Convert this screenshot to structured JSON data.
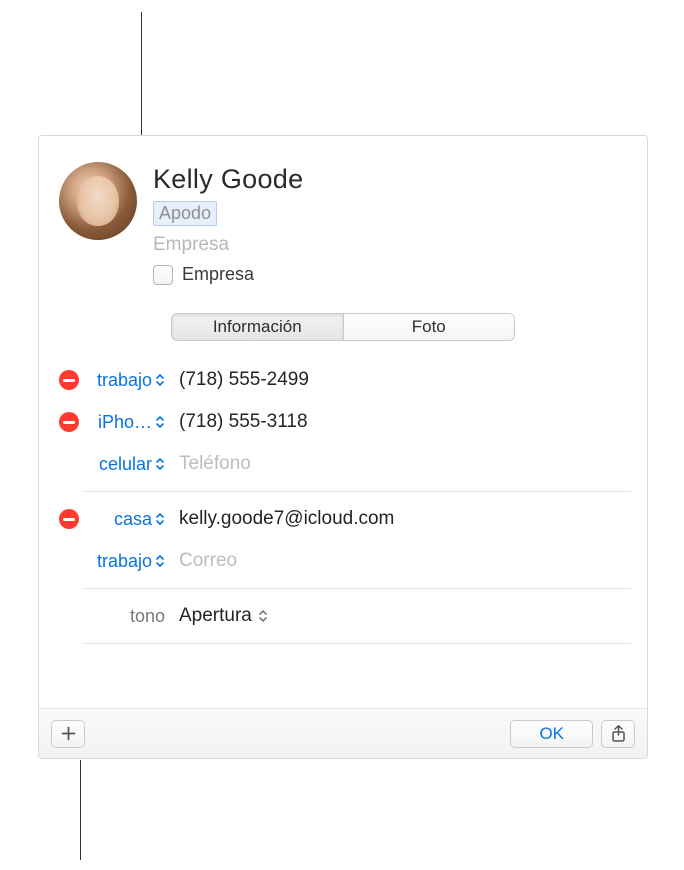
{
  "contact": {
    "name": "Kelly  Goode",
    "nickname_placeholder": "Apodo",
    "company_placeholder": "Empresa",
    "company_checkbox_label": "Empresa"
  },
  "tabs": {
    "info": "Información",
    "photo": "Foto"
  },
  "phones": [
    {
      "label": "trabajo",
      "value": "(718) 555-2499",
      "removable": true
    },
    {
      "label": "iPho…",
      "value": "(718) 555-3118",
      "removable": true
    },
    {
      "label": "celular",
      "value_placeholder": "Teléfono",
      "removable": false
    }
  ],
  "emails": [
    {
      "label": "casa",
      "value": "kelly.goode7@icloud.com",
      "removable": true
    },
    {
      "label": "trabajo",
      "value_placeholder": "Correo",
      "removable": false
    }
  ],
  "ringtone": {
    "label": "tono",
    "value": "Apertura"
  },
  "footer": {
    "ok": "OK"
  }
}
